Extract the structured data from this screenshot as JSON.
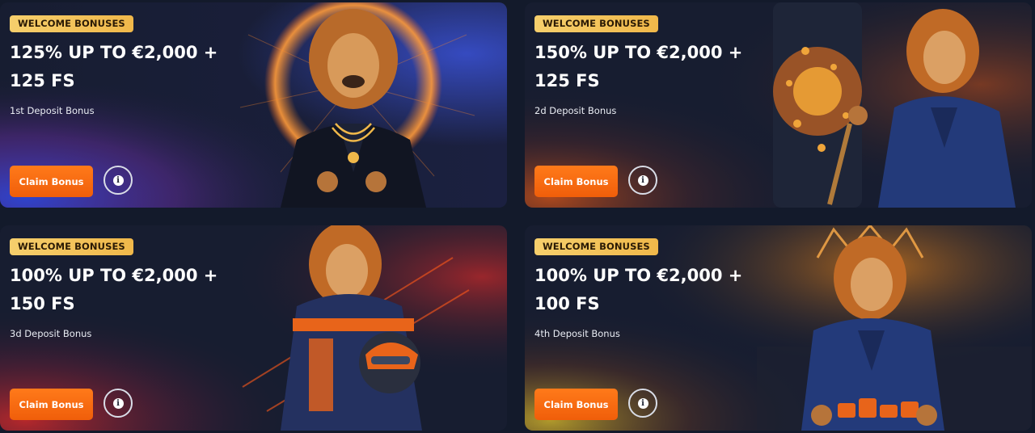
{
  "cards": [
    {
      "badge": "WELCOME BONUSES",
      "title_line1": "125% UP TO €2,000 +",
      "title_line2": "125 FS",
      "subtitle": "1st Deposit Bonus",
      "claim_label": "Claim Bonus",
      "info_icon": "i",
      "art": "lion-in-black-suit-with-gold-chains-halo",
      "accent": "#3a4fd0"
    },
    {
      "badge": "WELCOME BONUSES",
      "title_line1": "150% UP TO €2,000 +",
      "title_line2": "125 FS",
      "subtitle": "2d Deposit Bonus",
      "claim_label": "Claim Bonus",
      "info_icon": "i",
      "art": "lion-in-blue-suit-pulling-slot-machine-lever",
      "accent": "#e05a1a"
    },
    {
      "badge": "WELCOME BONUSES",
      "title_line1": "100% UP TO €2,000 +",
      "title_line2": "150 FS",
      "subtitle": "3d Deposit Bonus",
      "claim_label": "Claim Bonus",
      "info_icon": "i",
      "art": "lion-racing-driver-with-helmet",
      "accent": "#c8282a"
    },
    {
      "badge": "WELCOME BONUSES",
      "title_line1": "100% UP TO €2,000 +",
      "title_line2": "100 FS",
      "subtitle": "4th Deposit Bonus",
      "claim_label": "Claim Bonus",
      "info_icon": "i",
      "art": "lion-king-at-casino-table-with-chips",
      "accent": "#c9a227"
    }
  ]
}
